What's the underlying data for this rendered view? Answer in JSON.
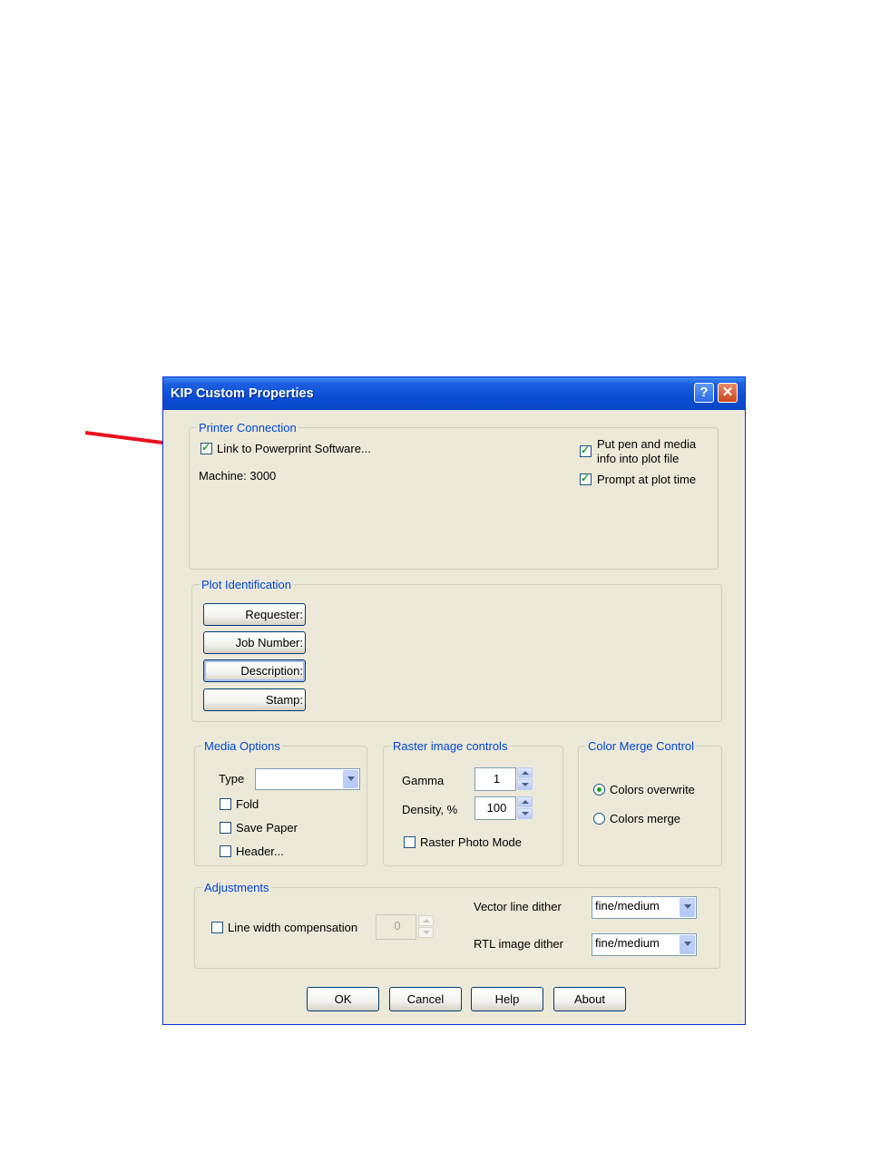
{
  "window": {
    "title": "KIP Custom Properties",
    "help_glyph": "?",
    "close_glyph": "✕"
  },
  "printer_connection": {
    "legend": "Printer Connection",
    "link_label": "Link to Powerprint Software...",
    "link_checked": true,
    "machine": "Machine: 3000",
    "put_pen_label_line1": "Put pen and media",
    "put_pen_label_line2": "info into plot file",
    "put_pen_checked": true,
    "prompt_label": "Prompt at plot time",
    "prompt_checked": true
  },
  "plot_identification": {
    "legend": "Plot Identification",
    "buttons": [
      "Requester:",
      "Job Number:",
      "Description:",
      "Stamp:"
    ]
  },
  "media_options": {
    "legend": "Media Options",
    "type_label": "Type",
    "type_value": "",
    "fold_label": "Fold",
    "save_paper_label": "Save Paper",
    "header_label": "Header..."
  },
  "raster": {
    "legend": "Raster image controls",
    "gamma_label": "Gamma",
    "gamma_value": "1",
    "density_label": "Density, %",
    "density_value": "100",
    "photo_mode_label": "Raster Photo Mode"
  },
  "color_merge": {
    "legend": "Color Merge Control",
    "overwrite_label": "Colors overwrite",
    "merge_label": "Colors merge",
    "selected": "overwrite"
  },
  "adjustments": {
    "legend": "Adjustments",
    "line_width_label": "Line width compensation",
    "line_width_value": "0",
    "vector_dither_label": "Vector line dither",
    "vector_dither_value": "fine/medium",
    "rtl_dither_label": "RTL image dither",
    "rtl_dither_value": "fine/medium"
  },
  "footer": {
    "ok": "OK",
    "cancel": "Cancel",
    "help": "Help",
    "about": "About"
  },
  "colors": {
    "titlebar": "#0a4ed6",
    "dialog_bg": "#ece9d8",
    "legend": "#0046d5",
    "arrow": "#e8101e"
  }
}
